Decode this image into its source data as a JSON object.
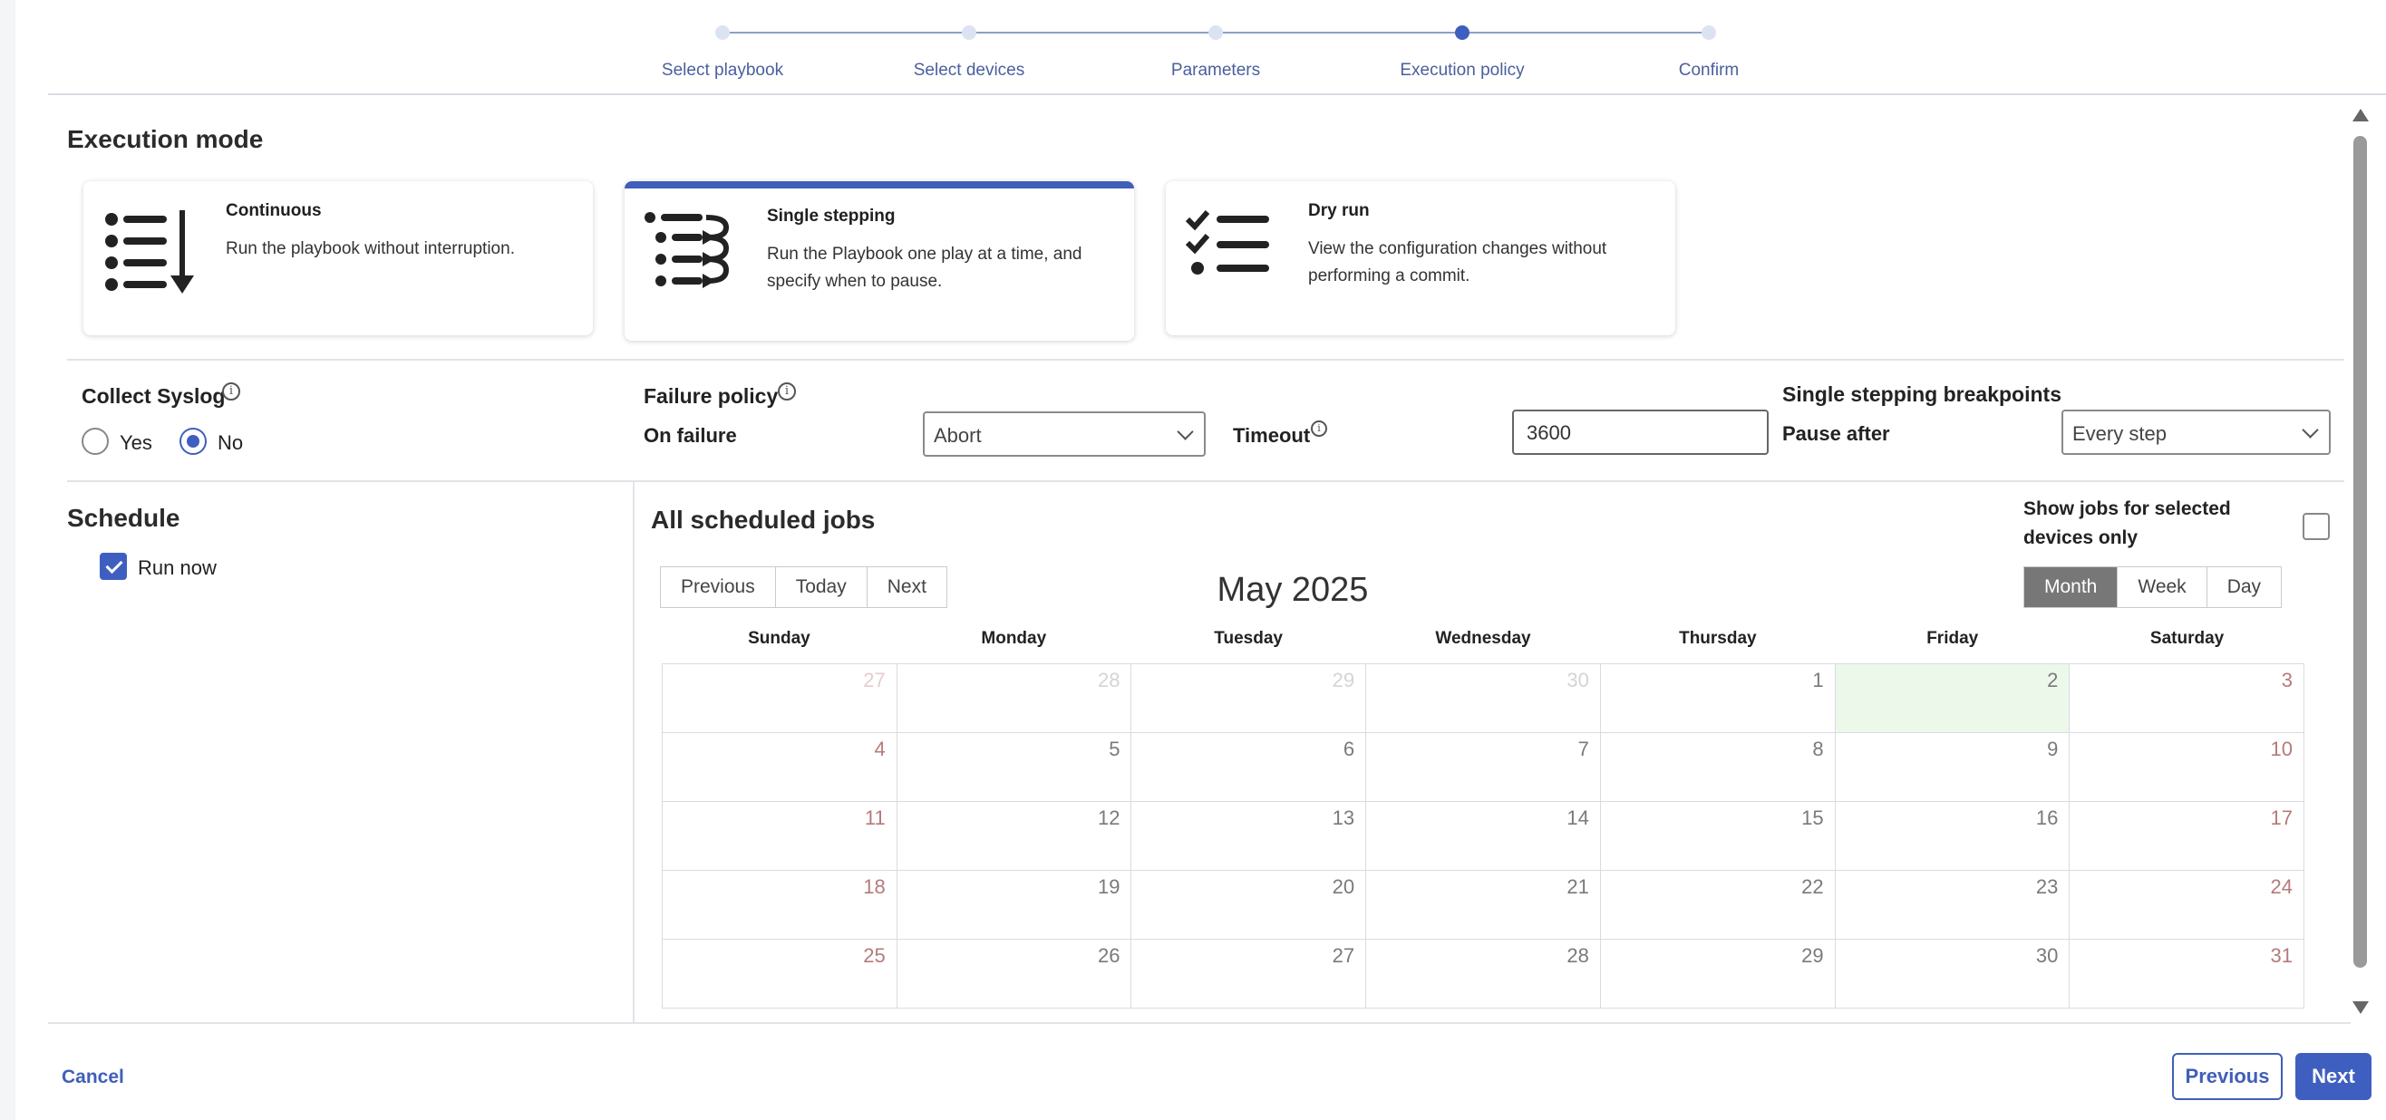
{
  "stepper": {
    "steps": [
      {
        "label": "Select playbook",
        "active": false
      },
      {
        "label": "Select devices",
        "active": false
      },
      {
        "label": "Parameters",
        "active": false
      },
      {
        "label": "Execution policy",
        "active": true
      },
      {
        "label": "Confirm",
        "active": false
      }
    ]
  },
  "execution_mode": {
    "title": "Execution mode",
    "cards": [
      {
        "title": "Continuous",
        "desc": "Run the playbook without interruption.",
        "icon": "list-arrow-down-icon",
        "selected": false
      },
      {
        "title": "Single stepping",
        "desc": "Run the Playbook one play at a time, and specify when to pause.",
        "icon": "list-step-arrows-icon",
        "selected": true
      },
      {
        "title": "Dry run",
        "desc": "View the configuration changes without performing a commit.",
        "icon": "checklist-icon",
        "selected": false
      }
    ]
  },
  "syslog": {
    "title": "Collect Syslog",
    "yes_label": "Yes",
    "no_label": "No",
    "selected": "No"
  },
  "failure_policy": {
    "title": "Failure policy",
    "on_failure_label": "On failure",
    "on_failure_value": "Abort",
    "timeout_label": "Timeout",
    "timeout_value": "3600"
  },
  "breakpoints": {
    "title": "Single stepping breakpoints",
    "pause_after_label": "Pause after",
    "pause_after_value": "Every step"
  },
  "schedule": {
    "title": "Schedule",
    "run_now_label": "Run now",
    "run_now_checked": true
  },
  "calendar": {
    "title": "All scheduled jobs",
    "show_selected_label": "Show jobs for selected devices only",
    "nav": {
      "previous": "Previous",
      "today": "Today",
      "next": "Next"
    },
    "month_title": "May 2025",
    "views": {
      "month": "Month",
      "week": "Week",
      "day": "Day",
      "active": "Month"
    },
    "weekdays": [
      "Sunday",
      "Monday",
      "Tuesday",
      "Wednesday",
      "Thursday",
      "Friday",
      "Saturday"
    ],
    "weeks": [
      [
        "27",
        "28",
        "29",
        "30",
        "1",
        "2",
        "3"
      ],
      [
        "4",
        "5",
        "6",
        "7",
        "8",
        "9",
        "10"
      ],
      [
        "11",
        "12",
        "13",
        "14",
        "15",
        "16",
        "17"
      ],
      [
        "18",
        "19",
        "20",
        "21",
        "22",
        "23",
        "24"
      ],
      [
        "25",
        "26",
        "27",
        "28",
        "29",
        "30",
        "31"
      ]
    ],
    "today": "2"
  },
  "footer": {
    "cancel_label": "Cancel",
    "previous_label": "Previous",
    "next_label": "Next"
  },
  "colors": {
    "accent": "#3f5fc0",
    "today_bg": "#ecf8ea",
    "weekend_text": "#b57a7a"
  }
}
